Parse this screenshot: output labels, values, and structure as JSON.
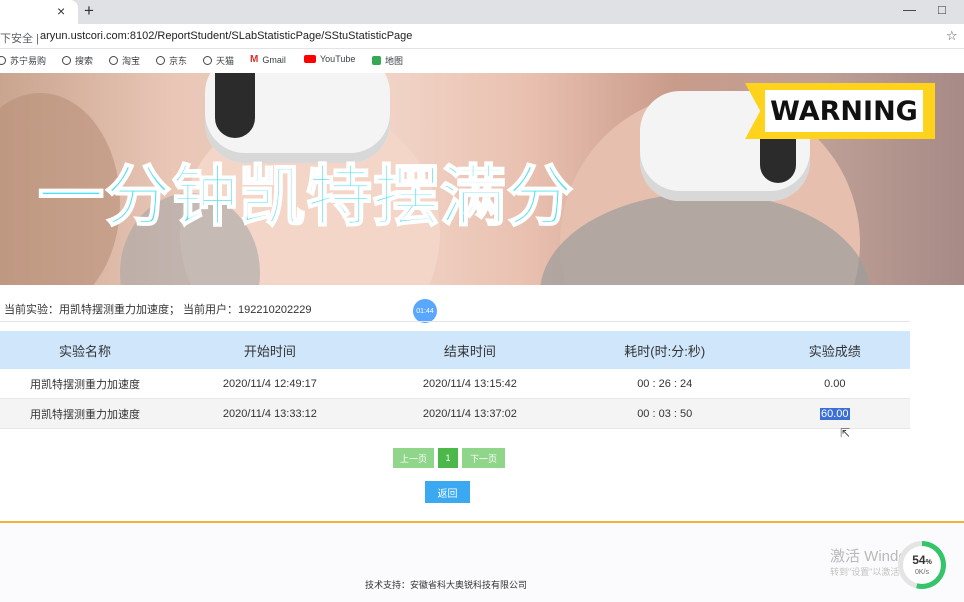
{
  "browser": {
    "tab_close": "×",
    "new_tab": "+",
    "window_minimize": "—",
    "window_maximize": "□",
    "security": "下安全 |",
    "url": "aryun.ustcori.com:8102/ReportStudent/SLabStatisticPage/SStuStatisticPage",
    "bookmarks": [
      "苏宁易购",
      "搜索",
      "淘宝",
      "京东",
      "天猫",
      "Gmail",
      "YouTube",
      "地图"
    ]
  },
  "banner": {
    "overlay_title": "一分钟凯特摆满分",
    "warning": "WARNING"
  },
  "info": {
    "text": "当前实验：用凯特摆测重力加速度；  当前用户：192210202229",
    "timer": "01:44"
  },
  "table": {
    "headers": [
      "实验名称",
      "开始时间",
      "结束时间",
      "耗时(时:分:秒)",
      "实验成绩"
    ],
    "rows": [
      [
        "用凯特摆测重力加速度",
        "2020/11/4 12:49:17",
        "2020/11/4 13:15:42",
        "00 : 26 : 24",
        "0.00"
      ],
      [
        "用凯特摆测重力加速度",
        "2020/11/4 13:33:12",
        "2020/11/4 13:37:02",
        "00 : 03 : 50",
        "60.00"
      ]
    ]
  },
  "pager": {
    "prev": "上一页",
    "page": "1",
    "next": "下一页",
    "back": "返回"
  },
  "footer": {
    "support": "技术支持：安徽省科大奥锐科技有限公司",
    "activate_title": "激活 Windows",
    "activate_sub": "转到\"设置\"以激活 Windows。"
  },
  "overlay_widget": {
    "percent": "54",
    "unit": "%",
    "sub": "0K/s"
  },
  "colors": {
    "header_bg": "#cfe6fb",
    "pager_green": "#8fd58a",
    "back_blue": "#3aa9f2",
    "footer_line": "#f2b23a",
    "title_cyan": "#4de0f2"
  }
}
